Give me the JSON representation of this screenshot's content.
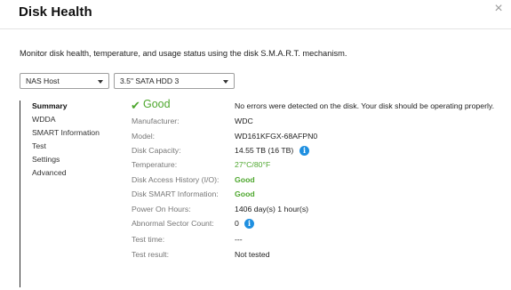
{
  "dialog": {
    "title": "Disk Health",
    "close_glyph": "×",
    "description": "Monitor disk health, temperature, and usage status using the disk S.M.A.R.T. mechanism."
  },
  "selectors": {
    "host": "NAS Host",
    "disk": "3.5\" SATA HDD 3"
  },
  "nav": {
    "items": [
      "Summary",
      "WDDA",
      "SMART Information",
      "Test",
      "Settings",
      "Advanced"
    ],
    "active": "Summary"
  },
  "summary": {
    "status": "Good",
    "status_icon": "check-icon",
    "status_message": "No errors were detected on the disk. Your disk should be operating properly.",
    "rows": [
      {
        "label": "Manufacturer:",
        "value": "WDC"
      },
      {
        "label": "Model:",
        "value": "WD161KFGX-68AFPN0"
      },
      {
        "label": "Disk Capacity:",
        "value": "14.55 TB (16 TB)"
      },
      {
        "label": "Temperature:",
        "value": "27°C/80°F"
      },
      {
        "label": "Disk Access History (I/O):",
        "value": "Good"
      },
      {
        "label": "Disk SMART Information:",
        "value": "Good"
      },
      {
        "label": "Power On Hours:",
        "value": "1406 day(s) 1 hour(s)"
      },
      {
        "label": "Abnormal Sector Count:",
        "value": "0"
      },
      {
        "label": "Test time:",
        "value": "---"
      },
      {
        "label": "Test result:",
        "value": "Not tested"
      }
    ]
  },
  "colors": {
    "good_green": "#4ea72e",
    "info_blue": "#1e8fe0"
  },
  "icons": {
    "info": "info-icon",
    "close": "close-icon"
  }
}
